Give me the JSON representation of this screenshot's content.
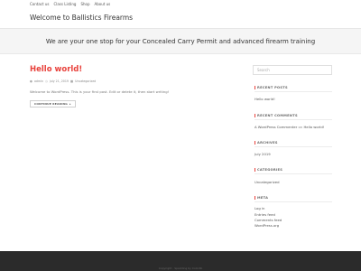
{
  "topnav": [
    "Contact us",
    "Class Listing",
    "Shop",
    "About us"
  ],
  "site": {
    "title": "Welcome to Ballistics Firearms"
  },
  "hero": {
    "text": "We are your one stop for your Concealed Carry Permit and advanced firearm training"
  },
  "post": {
    "title": "Hello world!",
    "author": "admin",
    "date": "July 21, 2019",
    "category": "Uncategorized",
    "excerpt": "Welcome to WordPress. This is your first post. Edit or delete it, then start writing!",
    "read_more": "CONTINUE READING"
  },
  "sidebar": {
    "search_placeholder": "Search",
    "recent_posts": {
      "title": "RECENT POSTS",
      "items": [
        "Hello world!"
      ]
    },
    "recent_comments": {
      "title": "RECENT COMMENTS",
      "author": "A WordPress Commenter",
      "on": "on",
      "post": "Hello world!"
    },
    "archives": {
      "title": "ARCHIVES",
      "items": [
        "July 2019"
      ]
    },
    "categories": {
      "title": "CATEGORIES",
      "items": [
        "Uncategorized"
      ]
    },
    "meta": {
      "title": "META",
      "items": [
        "Log in",
        "Entries feed",
        "Comments feed",
        "WordPress.org"
      ]
    }
  },
  "footer": {
    "text": "Copyright · Sparkling by Colorlib"
  },
  "colors": {
    "accent": "#e8413b",
    "footer_bg": "#2b2b2b",
    "hero_bg": "#f5f5f5"
  },
  "icons": {
    "author": "user-icon",
    "date": "clock-icon",
    "category": "folder-icon",
    "read_more": "chevron-right-icon"
  }
}
